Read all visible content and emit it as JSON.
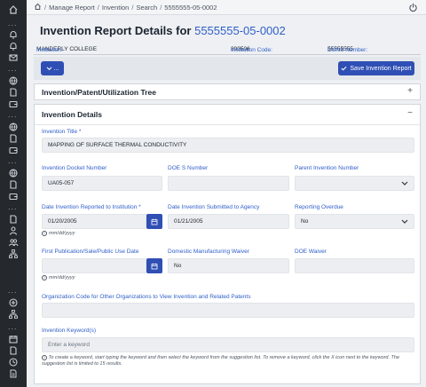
{
  "sidebar": {
    "icons": [
      "home-icon",
      "bell-icon",
      "bell-icon",
      "mail-icon",
      "globe-icon",
      "document-icon",
      "wallet-icon",
      "globe-icon",
      "document-icon",
      "wallet-icon",
      "globe-icon",
      "document-icon",
      "wallet-icon",
      "person-icon",
      "people-icon",
      "org-tree-icon",
      "add-circle-icon",
      "org-tree-icon",
      "calendar-icon",
      "document-icon",
      "report-icon",
      "report-icon"
    ]
  },
  "breadcrumb": {
    "items": [
      "Manage Report",
      "Invention",
      "Search",
      "5555555-05-0002"
    ]
  },
  "page": {
    "title": "Invention Report Details for",
    "title_number": "5555555-05-0002"
  },
  "info": {
    "institution_label": "Institution:",
    "institution_value": "MANDERLY COLLEGE",
    "code_label": "Institution Code:",
    "code_value": "890506",
    "duns_label": "DUNS Number:",
    "duns_value": "55555555"
  },
  "actions": {
    "dropdown_label": "...",
    "save_label": "Save Invention Report"
  },
  "tree_panel": {
    "title": "Invention/Patent/Utilization Tree",
    "toggle": "+"
  },
  "details_panel": {
    "title": "Invention Details",
    "toggle": "−",
    "invention_title": {
      "label": "Invention Title *",
      "value": "MAPPING OF SURFACE THERMAL CONDUCTIVITY"
    },
    "docket": {
      "label": "Invention Docket Number",
      "value": "UA05-057"
    },
    "doe_s": {
      "label": "DOE S Number",
      "value": ""
    },
    "parent": {
      "label": "Parent Invention Number",
      "value": ""
    },
    "date_reported": {
      "label": "Date Invention Reported to Institution *",
      "value": "01/20/2005"
    },
    "date_submitted": {
      "label": "Date Invention Submitted to Agency",
      "value": "01/21/2005"
    },
    "reporting_overdue": {
      "label": "Reporting Overdue",
      "value": "No"
    },
    "date_hint": "mm/dd/yyyy",
    "first_pub": {
      "label": "First Publication/Sale/Public Use Date",
      "value": ""
    },
    "domestic_waiver": {
      "label": "Domestic Manufacturing Waiver",
      "value": "No"
    },
    "doe_waiver": {
      "label": "DOE Waiver",
      "value": ""
    },
    "org_code": {
      "label": "Organization Code for Other Organizations to View Invention and Related Patents",
      "value": ""
    },
    "keywords": {
      "label": "Invention Keyword(s)",
      "placeholder": "Enter a keyword"
    },
    "keyword_help": "To create a keyword, start typing the keyword and then select the keyword from the suggestion list. To remove a keyword, click the X icon next to the keyword. The suggestion list is limited to 15 results."
  },
  "colors": {
    "accent": "#2f4fb5",
    "link": "#2f5ec9",
    "sidebar": "#25282c"
  }
}
